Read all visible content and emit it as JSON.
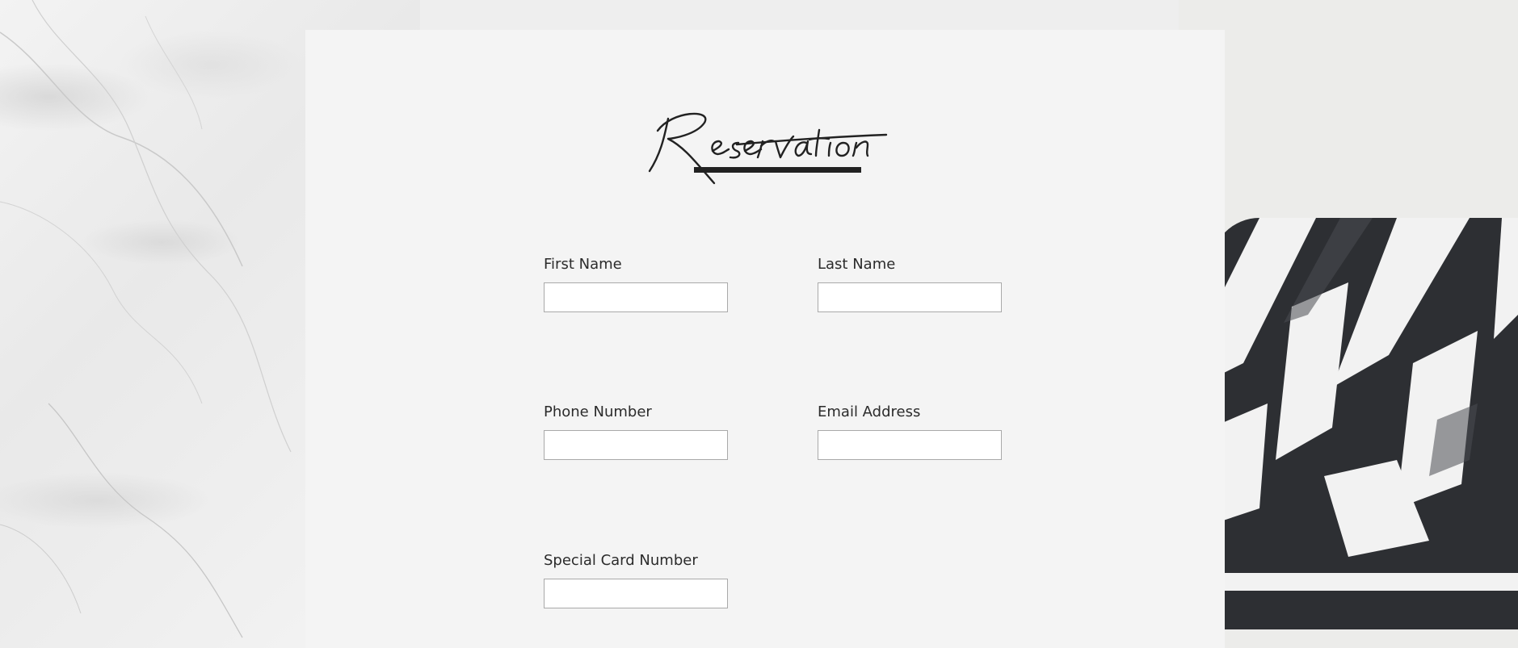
{
  "form": {
    "title": "Reservation",
    "fields": {
      "first_name": {
        "label": "First Name",
        "value": "",
        "placeholder": ""
      },
      "last_name": {
        "label": "Last Name",
        "value": "",
        "placeholder": ""
      },
      "phone_number": {
        "label": "Phone Number",
        "value": "",
        "placeholder": ""
      },
      "email_address": {
        "label": "Email Address",
        "value": "",
        "placeholder": ""
      },
      "special_card_number": {
        "label": "Special Card Number",
        "value": "",
        "placeholder": ""
      }
    }
  },
  "colors": {
    "panel_background": "#f4f4f4",
    "text": "#2b2b2b",
    "input_border": "#a9a9a9",
    "logo": "#222222"
  },
  "background": {
    "left": "marble-texture",
    "right": "striped-towel"
  }
}
